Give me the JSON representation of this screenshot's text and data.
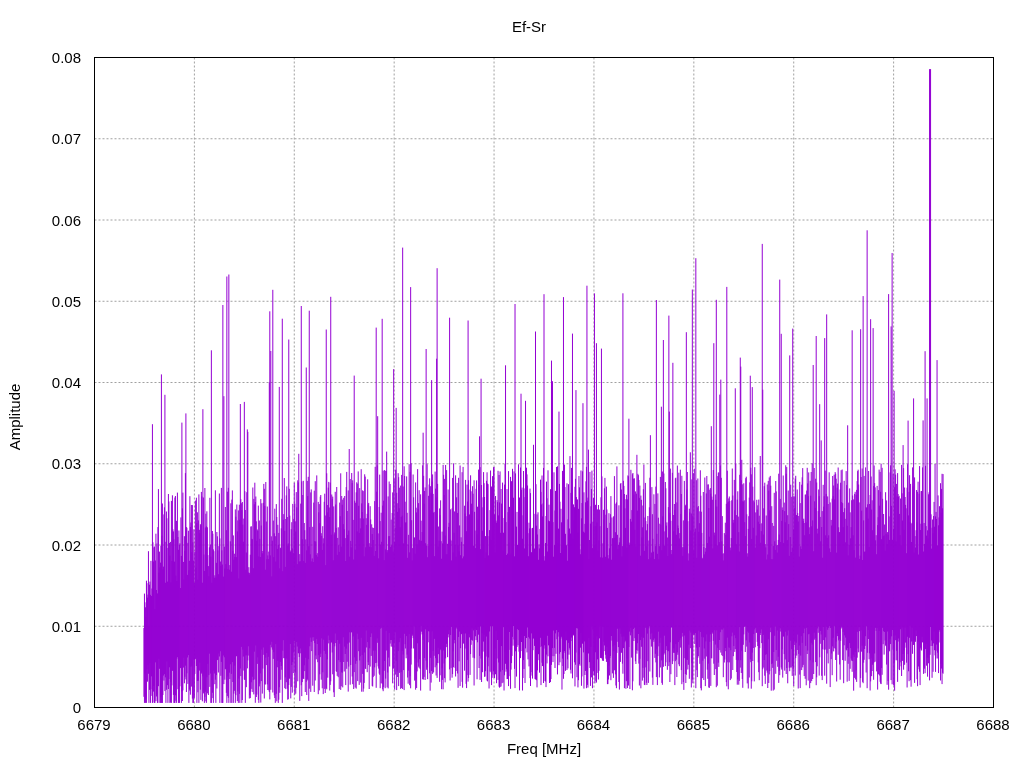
{
  "chart": {
    "title": "Ef-Sr",
    "xlabel": "Freq [MHz]",
    "ylabel": "Amplitude",
    "yticks": [
      "0.08",
      "0.07",
      "0.06",
      "0.05",
      "0.04",
      "0.03",
      "0.02",
      "0.01",
      "0"
    ],
    "xticks": [
      "6679",
      "6680",
      "6681",
      "6682",
      "6683",
      "6684",
      "6685",
      "6686",
      "6687",
      "6688"
    ]
  }
}
